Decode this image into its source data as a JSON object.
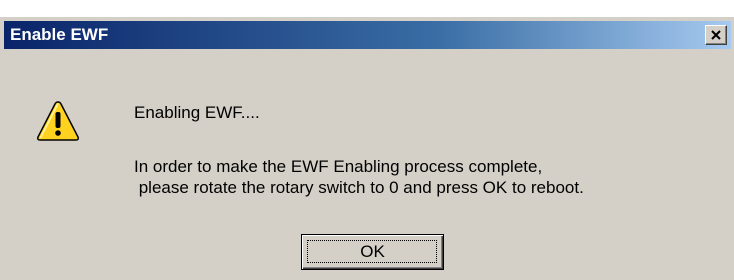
{
  "dialog": {
    "title": "Enable EWF",
    "close_label": "close",
    "icon": "warning-icon",
    "message_line1": "Enabling EWF....",
    "message_line2": "In order to make the EWF Enabling process complete,",
    "message_line3": " please rotate the rotary switch to 0 and press OK to reboot.",
    "ok_label": "OK"
  },
  "colors": {
    "titlebar_start": "#0a246a",
    "titlebar_end": "#a6caf0",
    "dialog_bg": "#d4d0c8",
    "warning_fill": "#ffd21f"
  }
}
